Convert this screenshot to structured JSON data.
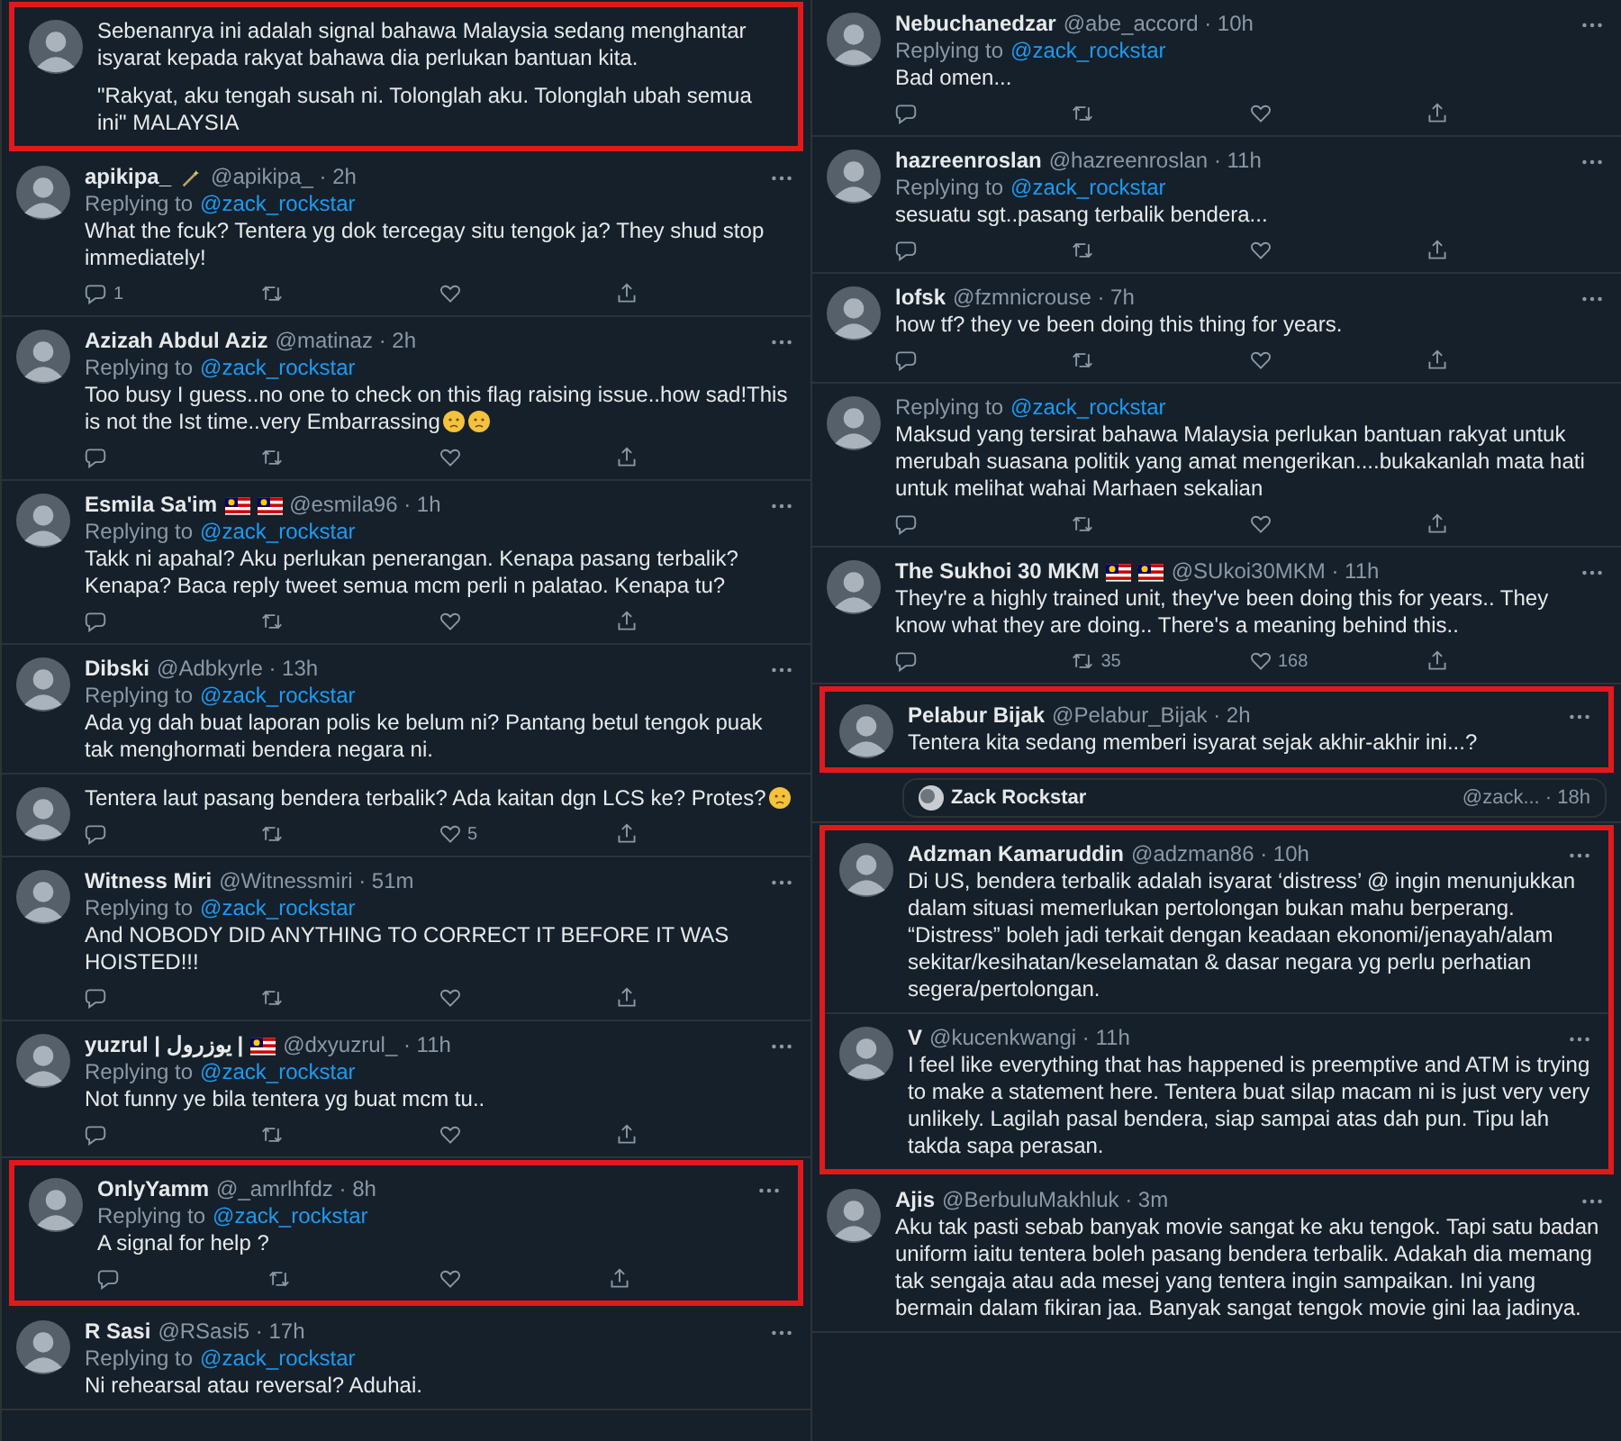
{
  "columns": [
    {
      "blocks": [
        {
          "highlighted": true,
          "tweets": [
            {
              "text": [
                "Sebenanrya ini adalah signal bahawa Malaysia sedang menghantar isyarat kepada rakyat bahawa dia perlukan bantuan kita.",
                "\"Rakyat, aku tengah susah ni. Tolonglah aku. Tolonglah ubah semua ini\" MALAYSIA"
              ]
            }
          ]
        },
        {
          "highlighted": false,
          "tweets": [
            {
              "name": "apikipa_",
              "icons": [
                {
                  "kind": "wand"
                }
              ],
              "handle": "@apikipa_ · 2h",
              "replying": "Replying to",
              "reply_to": "@zack_rockstar",
              "text": [
                "What the fcuk? Tentera yg dok tercegay situ tengok ja? They shud stop immediately!"
              ],
              "actions": [
                {
                  "kind": "reply",
                  "count": "1"
                },
                {
                  "kind": "retweet"
                },
                {
                  "kind": "like"
                },
                {
                  "kind": "share"
                }
              ]
            },
            {
              "name": "Azizah Abdul Aziz",
              "handle": "@matinaz · 2h",
              "replying": "Replying to",
              "reply_to": "@zack_rockstar",
              "text": [
                "Too busy I guess..no one to check on this flag raising issue..how sad!This is not the Ist time..very Embarrassing"
              ],
              "end_icons": [
                {
                  "kind": "face"
                },
                {
                  "kind": "face"
                }
              ],
              "actions": [
                {
                  "kind": "reply"
                },
                {
                  "kind": "retweet"
                },
                {
                  "kind": "like"
                },
                {
                  "kind": "share"
                }
              ]
            },
            {
              "name": "Esmila Sa'im",
              "icons": [
                {
                  "kind": "flag"
                },
                {
                  "kind": "flag"
                }
              ],
              "handle": "@esmila96 · 1h",
              "replying": "Replying to",
              "reply_to": "@zack_rockstar",
              "text": [
                "Takk ni apahal? Aku perlukan penerangan. Kenapa pasang terbalik? Kenapa? Baca reply tweet semua mcm perli n palatao. Kenapa tu?"
              ],
              "actions": [
                {
                  "kind": "reply"
                },
                {
                  "kind": "retweet"
                },
                {
                  "kind": "like"
                },
                {
                  "kind": "share"
                }
              ]
            },
            {
              "name": "Dibski",
              "handle": "@Adbkyrle · 13h",
              "replying": "Replying to",
              "reply_to": "@zack_rockstar",
              "text": [
                "Ada yg dah buat laporan polis ke belum ni? Pantang betul tengok puak tak menghormati bendera negara ni."
              ]
            },
            {
              "text": [
                "Tentera laut pasang bendera terbalik? Ada kaitan dgn LCS ke? Protes?"
              ],
              "end_icons": [
                {
                  "kind": "face"
                }
              ],
              "actions": [
                {
                  "kind": "reply"
                },
                {
                  "kind": "retweet"
                },
                {
                  "kind": "like",
                  "count": "5"
                },
                {
                  "kind": "share"
                }
              ]
            },
            {
              "name": "Witness Miri",
              "handle": "@Witnessmiri · 51m",
              "replying": "Replying to",
              "reply_to": "@zack_rockstar",
              "text": [
                "And NOBODY DID ANYTHING TO CORRECT IT BEFORE IT WAS HOISTED!!!"
              ],
              "actions": [
                {
                  "kind": "reply"
                },
                {
                  "kind": "retweet"
                },
                {
                  "kind": "like"
                },
                {
                  "kind": "share"
                }
              ]
            },
            {
              "name": "yuzrul | يوزرول |",
              "icons": [
                {
                  "kind": "flag"
                }
              ],
              "handle": "@dxyuzrul_ · 11h",
              "replying": "Replying to",
              "reply_to": "@zack_rockstar",
              "text": [
                "Not funny ye bila tentera yg buat mcm tu.."
              ],
              "actions": [
                {
                  "kind": "reply"
                },
                {
                  "kind": "retweet"
                },
                {
                  "kind": "like"
                },
                {
                  "kind": "share"
                }
              ]
            }
          ]
        },
        {
          "highlighted": true,
          "tweets": [
            {
              "name": "OnlyYamm",
              "handle": "@_amrlhfdz · 8h",
              "replying": "Replying to",
              "reply_to": "@zack_rockstar",
              "text": [
                "A signal for help ?"
              ],
              "actions": [
                {
                  "kind": "reply"
                },
                {
                  "kind": "retweet"
                },
                {
                  "kind": "like"
                },
                {
                  "kind": "share"
                }
              ]
            }
          ]
        },
        {
          "highlighted": false,
          "tweets": [
            {
              "name": "R Sasi",
              "handle": "@RSasi5 · 17h",
              "replying": "Replying to",
              "reply_to": "@zack_rockstar",
              "text": [
                "Ni rehearsal atau reversal? Aduhai."
              ]
            }
          ]
        }
      ]
    },
    {
      "blocks": [
        {
          "highlighted": false,
          "tweets": [
            {
              "name": "Nebuchanedzar",
              "handle": "@abe_accord · 10h",
              "replying": "Replying to",
              "reply_to": "@zack_rockstar",
              "text": [
                "Bad omen..."
              ],
              "actions": [
                {
                  "kind": "reply"
                },
                {
                  "kind": "retweet"
                },
                {
                  "kind": "like"
                },
                {
                  "kind": "share"
                }
              ]
            },
            {
              "name": "hazreenroslan",
              "handle": "@hazreenroslan · 11h",
              "replying": "Replying to",
              "reply_to": "@zack_rockstar",
              "text": [
                "sesuatu sgt..pasang terbalik bendera..."
              ],
              "actions": [
                {
                  "kind": "reply"
                },
                {
                  "kind": "retweet"
                },
                {
                  "kind": "like"
                },
                {
                  "kind": "share"
                }
              ]
            },
            {
              "name": "lofsk",
              "handle": "@fzmnicrouse · 7h",
              "text": [
                "how tf? they ve been doing this thing for years."
              ],
              "actions": [
                {
                  "kind": "reply"
                },
                {
                  "kind": "retweet"
                },
                {
                  "kind": "like"
                },
                {
                  "kind": "share"
                }
              ]
            },
            {
              "replying": "Replying to",
              "reply_to": "@zack_rockstar",
              "text": [
                "Maksud yang tersirat bahawa Malaysia perlukan bantuan rakyat untuk merubah suasana politik yang amat mengerikan....bukakanlah mata hati untuk melihat wahai Marhaen sekalian"
              ],
              "actions": [
                {
                  "kind": "reply"
                },
                {
                  "kind": "retweet"
                },
                {
                  "kind": "like"
                },
                {
                  "kind": "share"
                }
              ]
            },
            {
              "name": "The Sukhoi 30 MKM",
              "icons": [
                {
                  "kind": "flag"
                },
                {
                  "kind": "flag"
                }
              ],
              "handle": "@SUkoi30MKM · 11h",
              "text": [
                "They're a highly trained unit, they've been doing this for years.. They know what they are doing.. There's a meaning behind this.."
              ],
              "actions": [
                {
                  "kind": "reply"
                },
                {
                  "kind": "retweet",
                  "count": "35"
                },
                {
                  "kind": "like",
                  "count": "168"
                },
                {
                  "kind": "share"
                }
              ]
            }
          ]
        },
        {
          "highlighted": true,
          "tweets": [
            {
              "name": "Pelabur Bijak",
              "handle": "@Pelabur_Bijak · 2h",
              "text": [
                "Tentera kita sedang memberi isyarat sejak akhir-akhir ini...?"
              ]
            }
          ]
        },
        {
          "highlighted": false,
          "quote": {
            "name": "Zack Rockstar",
            "handle": "@zack... · 18h"
          }
        },
        {
          "highlighted": true,
          "tweets": [
            {
              "name": "Adzman Kamaruddin",
              "handle": "@adzman86 · 10h",
              "text": [
                "Di US, bendera terbalik adalah isyarat ‘distress’ @ ingin menunjukkan dalam situasi memerlukan pertolongan bukan mahu berperang. “Distress” boleh jadi terkait dengan keadaan ekonomi/jenayah/alam sekitar/kesihatan/keselamatan & dasar negara yg perlu perhatian segera/pertolongan."
              ]
            },
            {
              "name": "V",
              "handle": "@kucenkwangi · 11h",
              "text": [
                "I feel like everything that has happened is preemptive and ATM is trying to make a statement here. Tentera buat silap macam ni is just very very unlikely. Lagilah pasal bendera, siap sampai atas dah pun. Tipu lah takda sapa perasan."
              ]
            }
          ]
        },
        {
          "highlighted": false,
          "tweets": [
            {
              "name": "Ajis",
              "handle": "@BerbuluMakhluk · 3m",
              "text": [
                "Aku tak pasti sebab banyak movie sangat ke aku tengok. Tapi satu badan uniform iaitu tentera boleh pasang bendera terbalik. Adakah dia memang tak sengaja atau ada mesej yang tentera ingin sampaikan. Ini yang bermain dalam fikiran jaa. Banyak sangat tengok movie gini laa jadinya."
              ]
            }
          ]
        }
      ]
    }
  ]
}
